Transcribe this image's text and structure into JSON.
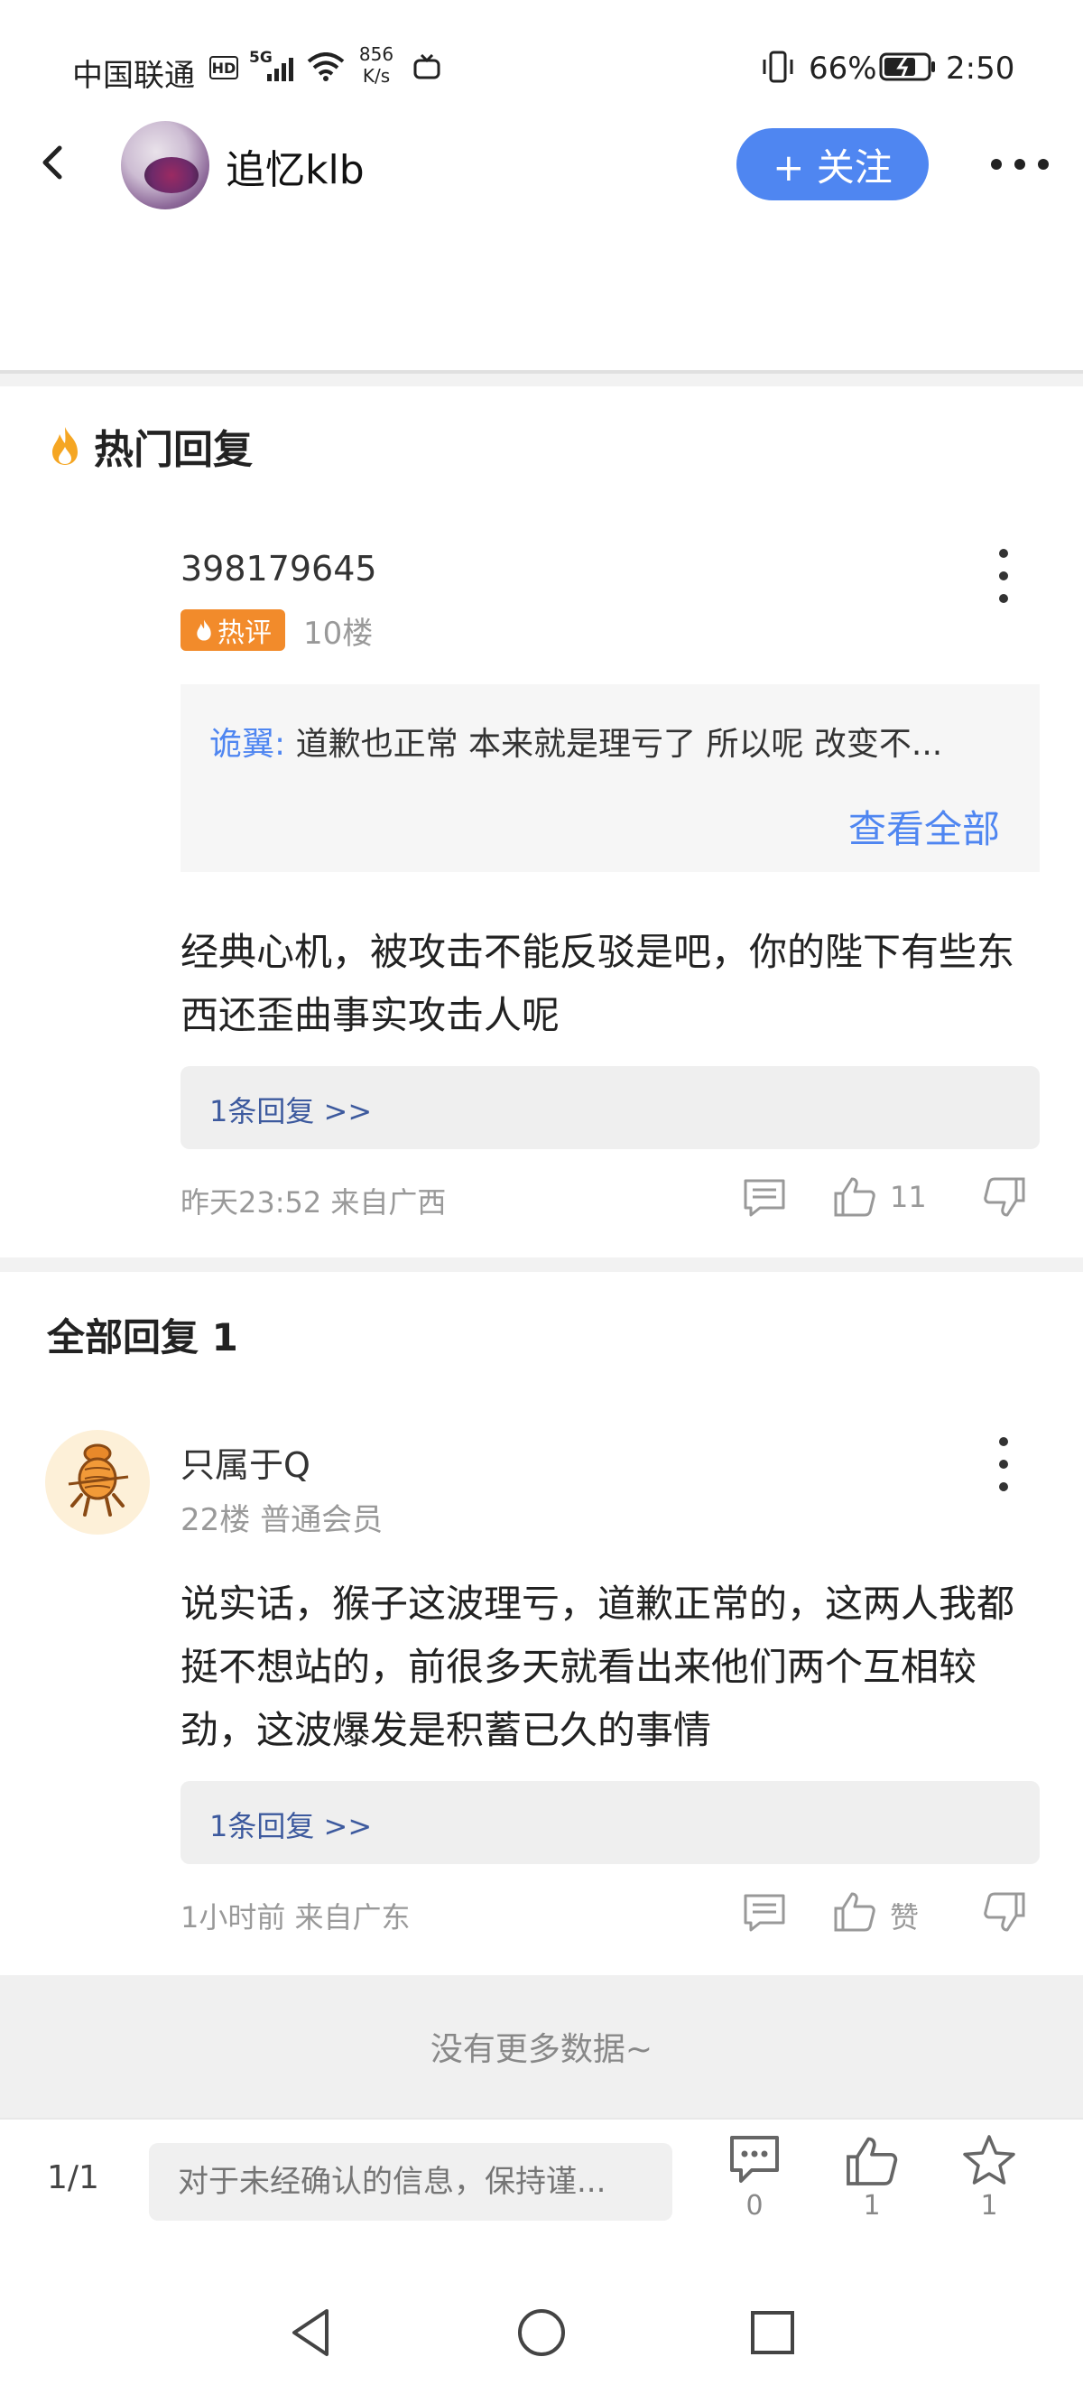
{
  "status_bar": {
    "carrier": "中国联通",
    "hd": "HD",
    "network": "5G",
    "speed_value": "856",
    "speed_unit": "K/s",
    "battery": "66%",
    "time": "2:50"
  },
  "header": {
    "username": "追忆klb",
    "follow_label": "+ 关注"
  },
  "hot_section": {
    "title": "热门回复",
    "comment": {
      "user_id": "398179645",
      "badge": "热评",
      "floor": "10楼",
      "quote_author": "诡翼:",
      "quote_text": " 道歉也正常 本来就是理亏了 所以呢 改变不...",
      "view_all": "查看全部",
      "text": "经典心机，被攻击不能反驳是吧，你的陛下有些东西还歪曲事实攻击人呢",
      "reply_link": "1条回复 >>",
      "time_location": "昨天23:52 来自广西",
      "like_count": "11"
    }
  },
  "all_section": {
    "title": "全部回复 1",
    "comment": {
      "name": "只属于Q",
      "sub": "22楼 普通会员",
      "text": "说实话，猴子这波理亏，道歉正常的，这两人我都挺不想站的，前很多天就看出来他们两个互相较劲，这波爆发是积蓄已久的事情",
      "reply_link": "1条回复 >>",
      "time_location": "1小时前 来自广东",
      "like_label": "赞"
    }
  },
  "no_more": "没有更多数据~",
  "bottom_bar": {
    "page": "1/1",
    "input_placeholder": "对于未经确认的信息，保持谨...",
    "comment_count": "0",
    "like_count": "1",
    "fav_count": "1"
  },
  "colors": {
    "accent": "#4f86f1",
    "hot_badge": "#f28b2b",
    "link": "#3d5a9e"
  }
}
